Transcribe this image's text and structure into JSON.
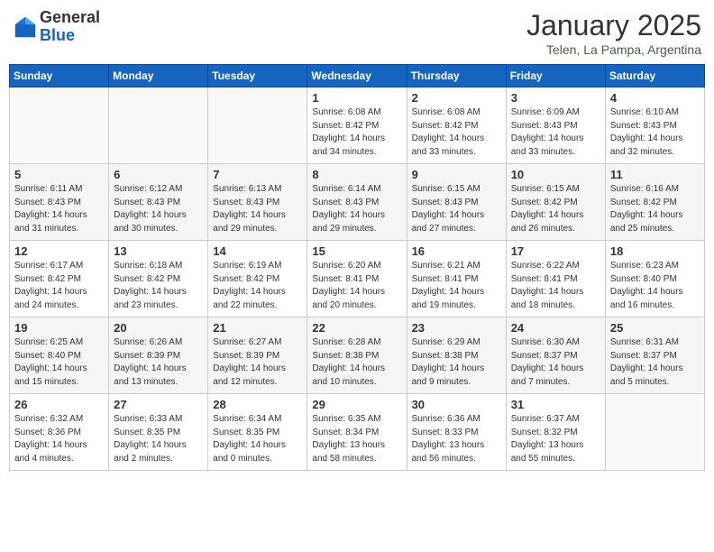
{
  "header": {
    "logo_general": "General",
    "logo_blue": "Blue",
    "month_title": "January 2025",
    "location": "Telen, La Pampa, Argentina"
  },
  "days_of_week": [
    "Sunday",
    "Monday",
    "Tuesday",
    "Wednesday",
    "Thursday",
    "Friday",
    "Saturday"
  ],
  "weeks": [
    [
      {
        "day": "",
        "sunrise": "",
        "sunset": "",
        "daylight": "",
        "empty": true
      },
      {
        "day": "",
        "sunrise": "",
        "sunset": "",
        "daylight": "",
        "empty": true
      },
      {
        "day": "",
        "sunrise": "",
        "sunset": "",
        "daylight": "",
        "empty": true
      },
      {
        "day": "1",
        "sunrise": "Sunrise: 6:08 AM",
        "sunset": "Sunset: 8:42 PM",
        "daylight": "Daylight: 14 hours and 34 minutes."
      },
      {
        "day": "2",
        "sunrise": "Sunrise: 6:08 AM",
        "sunset": "Sunset: 8:42 PM",
        "daylight": "Daylight: 14 hours and 33 minutes."
      },
      {
        "day": "3",
        "sunrise": "Sunrise: 6:09 AM",
        "sunset": "Sunset: 8:43 PM",
        "daylight": "Daylight: 14 hours and 33 minutes."
      },
      {
        "day": "4",
        "sunrise": "Sunrise: 6:10 AM",
        "sunset": "Sunset: 8:43 PM",
        "daylight": "Daylight: 14 hours and 32 minutes."
      }
    ],
    [
      {
        "day": "5",
        "sunrise": "Sunrise: 6:11 AM",
        "sunset": "Sunset: 8:43 PM",
        "daylight": "Daylight: 14 hours and 31 minutes."
      },
      {
        "day": "6",
        "sunrise": "Sunrise: 6:12 AM",
        "sunset": "Sunset: 8:43 PM",
        "daylight": "Daylight: 14 hours and 30 minutes."
      },
      {
        "day": "7",
        "sunrise": "Sunrise: 6:13 AM",
        "sunset": "Sunset: 8:43 PM",
        "daylight": "Daylight: 14 hours and 29 minutes."
      },
      {
        "day": "8",
        "sunrise": "Sunrise: 6:14 AM",
        "sunset": "Sunset: 8:43 PM",
        "daylight": "Daylight: 14 hours and 29 minutes."
      },
      {
        "day": "9",
        "sunrise": "Sunrise: 6:15 AM",
        "sunset": "Sunset: 8:43 PM",
        "daylight": "Daylight: 14 hours and 27 minutes."
      },
      {
        "day": "10",
        "sunrise": "Sunrise: 6:15 AM",
        "sunset": "Sunset: 8:42 PM",
        "daylight": "Daylight: 14 hours and 26 minutes."
      },
      {
        "day": "11",
        "sunrise": "Sunrise: 6:16 AM",
        "sunset": "Sunset: 8:42 PM",
        "daylight": "Daylight: 14 hours and 25 minutes."
      }
    ],
    [
      {
        "day": "12",
        "sunrise": "Sunrise: 6:17 AM",
        "sunset": "Sunset: 8:42 PM",
        "daylight": "Daylight: 14 hours and 24 minutes."
      },
      {
        "day": "13",
        "sunrise": "Sunrise: 6:18 AM",
        "sunset": "Sunset: 8:42 PM",
        "daylight": "Daylight: 14 hours and 23 minutes."
      },
      {
        "day": "14",
        "sunrise": "Sunrise: 6:19 AM",
        "sunset": "Sunset: 8:42 PM",
        "daylight": "Daylight: 14 hours and 22 minutes."
      },
      {
        "day": "15",
        "sunrise": "Sunrise: 6:20 AM",
        "sunset": "Sunset: 8:41 PM",
        "daylight": "Daylight: 14 hours and 20 minutes."
      },
      {
        "day": "16",
        "sunrise": "Sunrise: 6:21 AM",
        "sunset": "Sunset: 8:41 PM",
        "daylight": "Daylight: 14 hours and 19 minutes."
      },
      {
        "day": "17",
        "sunrise": "Sunrise: 6:22 AM",
        "sunset": "Sunset: 8:41 PM",
        "daylight": "Daylight: 14 hours and 18 minutes."
      },
      {
        "day": "18",
        "sunrise": "Sunrise: 6:23 AM",
        "sunset": "Sunset: 8:40 PM",
        "daylight": "Daylight: 14 hours and 16 minutes."
      }
    ],
    [
      {
        "day": "19",
        "sunrise": "Sunrise: 6:25 AM",
        "sunset": "Sunset: 8:40 PM",
        "daylight": "Daylight: 14 hours and 15 minutes."
      },
      {
        "day": "20",
        "sunrise": "Sunrise: 6:26 AM",
        "sunset": "Sunset: 8:39 PM",
        "daylight": "Daylight: 14 hours and 13 minutes."
      },
      {
        "day": "21",
        "sunrise": "Sunrise: 6:27 AM",
        "sunset": "Sunset: 8:39 PM",
        "daylight": "Daylight: 14 hours and 12 minutes."
      },
      {
        "day": "22",
        "sunrise": "Sunrise: 6:28 AM",
        "sunset": "Sunset: 8:38 PM",
        "daylight": "Daylight: 14 hours and 10 minutes."
      },
      {
        "day": "23",
        "sunrise": "Sunrise: 6:29 AM",
        "sunset": "Sunset: 8:38 PM",
        "daylight": "Daylight: 14 hours and 9 minutes."
      },
      {
        "day": "24",
        "sunrise": "Sunrise: 6:30 AM",
        "sunset": "Sunset: 8:37 PM",
        "daylight": "Daylight: 14 hours and 7 minutes."
      },
      {
        "day": "25",
        "sunrise": "Sunrise: 6:31 AM",
        "sunset": "Sunset: 8:37 PM",
        "daylight": "Daylight: 14 hours and 5 minutes."
      }
    ],
    [
      {
        "day": "26",
        "sunrise": "Sunrise: 6:32 AM",
        "sunset": "Sunset: 8:36 PM",
        "daylight": "Daylight: 14 hours and 4 minutes."
      },
      {
        "day": "27",
        "sunrise": "Sunrise: 6:33 AM",
        "sunset": "Sunset: 8:35 PM",
        "daylight": "Daylight: 14 hours and 2 minutes."
      },
      {
        "day": "28",
        "sunrise": "Sunrise: 6:34 AM",
        "sunset": "Sunset: 8:35 PM",
        "daylight": "Daylight: 14 hours and 0 minutes."
      },
      {
        "day": "29",
        "sunrise": "Sunrise: 6:35 AM",
        "sunset": "Sunset: 8:34 PM",
        "daylight": "Daylight: 13 hours and 58 minutes."
      },
      {
        "day": "30",
        "sunrise": "Sunrise: 6:36 AM",
        "sunset": "Sunset: 8:33 PM",
        "daylight": "Daylight: 13 hours and 56 minutes."
      },
      {
        "day": "31",
        "sunrise": "Sunrise: 6:37 AM",
        "sunset": "Sunset: 8:32 PM",
        "daylight": "Daylight: 13 hours and 55 minutes."
      },
      {
        "day": "",
        "sunrise": "",
        "sunset": "",
        "daylight": "",
        "empty": true
      }
    ]
  ]
}
